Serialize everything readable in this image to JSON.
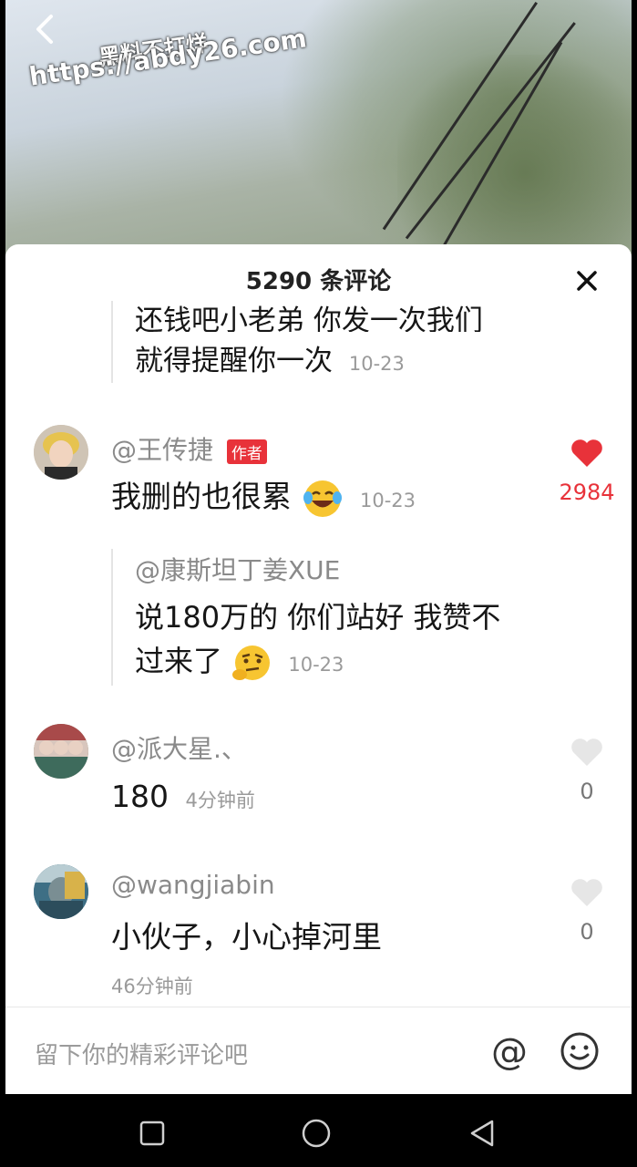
{
  "header": {
    "watermark_line1": "黑料不打烊",
    "watermark_line2": "https://abdy26.com"
  },
  "sheet": {
    "title": "5290 条评论",
    "partial_reply": {
      "line1": "还钱吧小老弟 你发一次我们",
      "line2": "就得提醒你一次",
      "time": "10-23"
    },
    "comments": [
      {
        "name": "@王传捷",
        "badge": "作者",
        "text": "我删的也很累",
        "emoji": "laughing-tears-emoji",
        "time": "10-23",
        "likes": "2984",
        "liked": true,
        "reply": {
          "name": "@康斯坦丁姜XUE",
          "line1": "说180万的 你们站好 我赞不",
          "line2": "过来了",
          "emoji": "thinking-emoji",
          "time": "10-23"
        }
      },
      {
        "name": "@派大星.、",
        "text": "180",
        "time": "4分钟前",
        "likes": "0",
        "liked": false
      },
      {
        "name": "@wangjiabin",
        "text": "小伙子，小心掉河里",
        "time": "46分钟前",
        "likes": "0",
        "liked": false
      }
    ]
  },
  "input": {
    "placeholder": "留下你的精彩评论吧"
  },
  "colors": {
    "accent": "#e8323a",
    "like_active": "#e8323a",
    "like_inactive": "#e6e6e6"
  }
}
